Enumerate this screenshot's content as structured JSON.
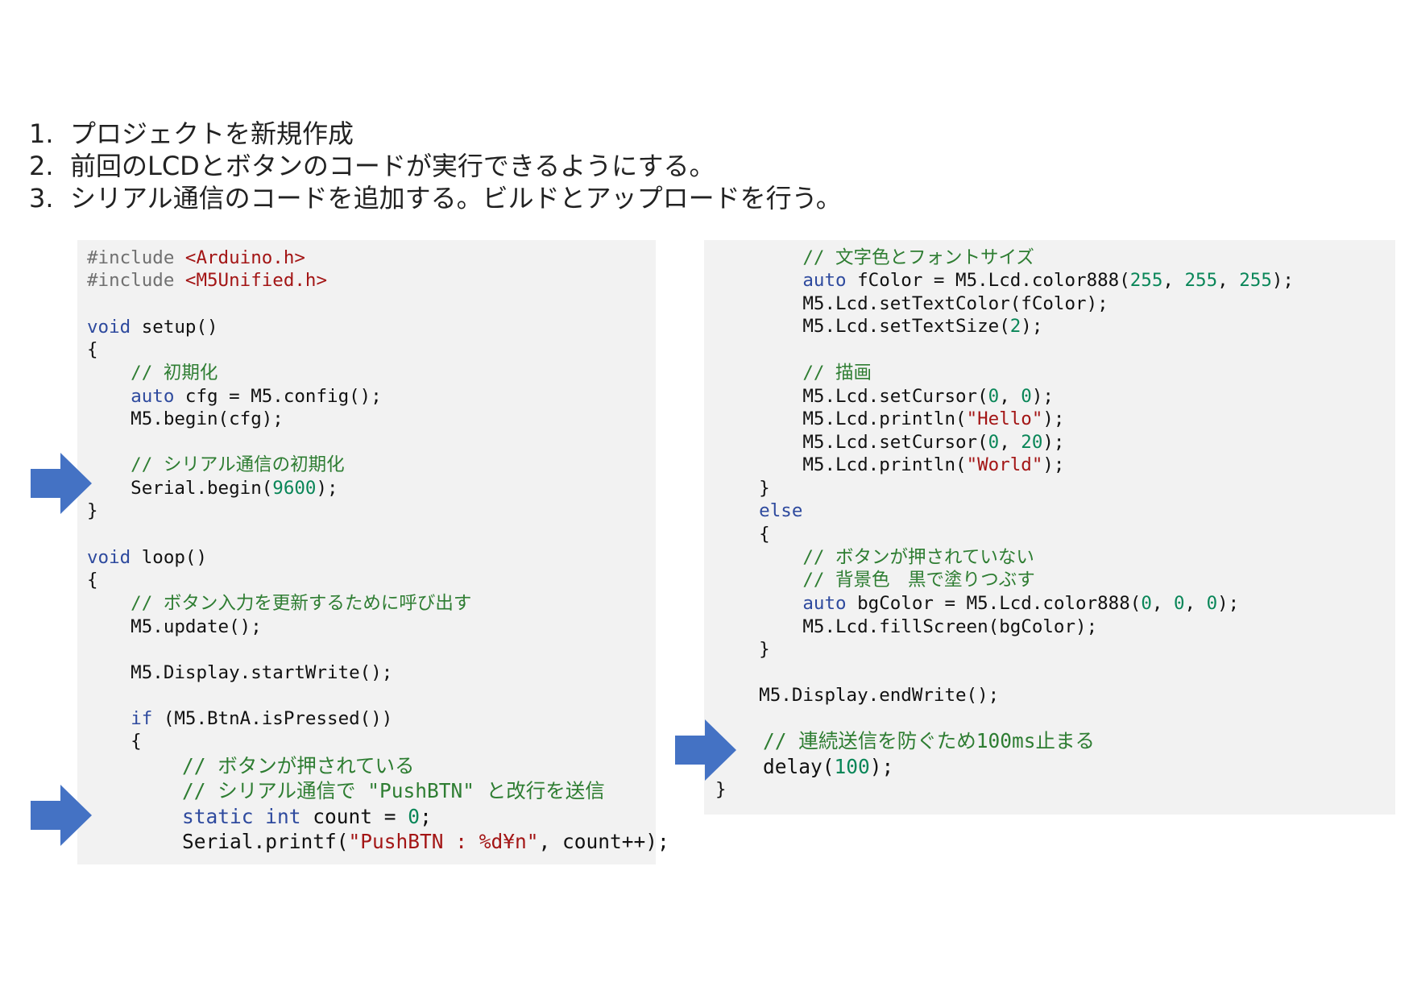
{
  "steps": [
    {
      "num": "1.",
      "text": "プロジェクトを新規作成"
    },
    {
      "num": "2.",
      "text": "前回のLCDとボタンのコードが実行できるようにする。"
    },
    {
      "num": "3.",
      "text": "シリアル通信のコードを追加する。ビルドとアップロードを行う。"
    }
  ],
  "code_left": {
    "l1": {
      "pre": "#include ",
      "inc": "<Arduino.h>"
    },
    "l2": {
      "pre": "#include ",
      "inc": "<M5Unified.h>"
    },
    "l4": {
      "kw": "void",
      "rest": " setup()"
    },
    "l5": {
      "text": "{"
    },
    "l6": {
      "com": "    // 初期化"
    },
    "l7": {
      "indent": "    ",
      "kw": "auto",
      "rest": " cfg = M5.config();"
    },
    "l8": {
      "text": "    M5.begin(cfg);"
    },
    "l10": {
      "com": "    // シリアル通信の初期化"
    },
    "l11": {
      "a": "    Serial.begin(",
      "num": "9600",
      "b": ");"
    },
    "l12": {
      "text": "}"
    },
    "l14": {
      "kw": "void",
      "rest": " loop()"
    },
    "l15": {
      "text": "{"
    },
    "l16": {
      "com": "    // ボタン入力を更新するために呼び出す"
    },
    "l17": {
      "text": "    M5.update();"
    },
    "l19": {
      "text": "    M5.Display.startWrite();"
    },
    "l21": {
      "indent": "    ",
      "kw": "if",
      "rest": " (M5.BtnA.isPressed())"
    },
    "l22": {
      "text": "    {"
    },
    "l23": {
      "com": "        // ボタンが押されている"
    },
    "l24": {
      "com": "        // シリアル通信で \"PushBTN\" と改行を送信"
    },
    "l25": {
      "indent": "        ",
      "kw": "static int",
      "a": " count = ",
      "num": "0",
      "b": ";"
    },
    "l26": {
      "a": "        Serial.printf(",
      "str": "\"PushBTN : %d¥n\"",
      "b": ", count++);"
    }
  },
  "code_right": {
    "r1": {
      "com": "        // 文字色とフォントサイズ"
    },
    "r2": {
      "indent": "        ",
      "kw": "auto",
      "a": " fColor = M5.Lcd.color888(",
      "n1": "255",
      "s1": ", ",
      "n2": "255",
      "s2": ", ",
      "n3": "255",
      "b": ");"
    },
    "r3": {
      "text": "        M5.Lcd.setTextColor(fColor);"
    },
    "r4": {
      "a": "        M5.Lcd.setTextSize(",
      "num": "2",
      "b": ");"
    },
    "r6": {
      "com": "        // 描画"
    },
    "r7": {
      "a": "        M5.Lcd.setCursor(",
      "n1": "0",
      "s1": ", ",
      "n2": "0",
      "b": ");"
    },
    "r8": {
      "a": "        M5.Lcd.println(",
      "str": "\"Hello\"",
      "b": ");"
    },
    "r9": {
      "a": "        M5.Lcd.setCursor(",
      "n1": "0",
      "s1": ", ",
      "n2": "20",
      "b": ");"
    },
    "r10": {
      "a": "        M5.Lcd.println(",
      "str": "\"World\"",
      "b": ");"
    },
    "r11": {
      "text": "    }"
    },
    "r12": {
      "kw": "    else"
    },
    "r13": {
      "text": "    {"
    },
    "r14": {
      "com": "        // ボタンが押されていない"
    },
    "r15": {
      "com": "        // 背景色　黒で塗りつぶす"
    },
    "r16": {
      "indent": "        ",
      "kw": "auto",
      "a": " bgColor = M5.Lcd.color888(",
      "n1": "0",
      "s1": ", ",
      "n2": "0",
      "s2": ", ",
      "n3": "0",
      "b": ");"
    },
    "r17": {
      "text": "        M5.Lcd.fillScreen(bgColor);"
    },
    "r18": {
      "text": "    }"
    },
    "r20": {
      "text": "    M5.Display.endWrite();"
    },
    "r22": {
      "com": "    // 連続送信を防ぐため100ms止まる"
    },
    "r23": {
      "a": "    delay(",
      "num": "100",
      "b": ");"
    },
    "r24": {
      "text": "}"
    }
  },
  "colors": {
    "panel_bg": "#f2f2f2",
    "keyword": "#2e4a9e",
    "comment": "#2e7d32",
    "number": "#098658",
    "string": "#a31515",
    "preprocessor": "#707070",
    "arrow": "#4472c4"
  },
  "icons": [
    "arrow-right-icon"
  ]
}
